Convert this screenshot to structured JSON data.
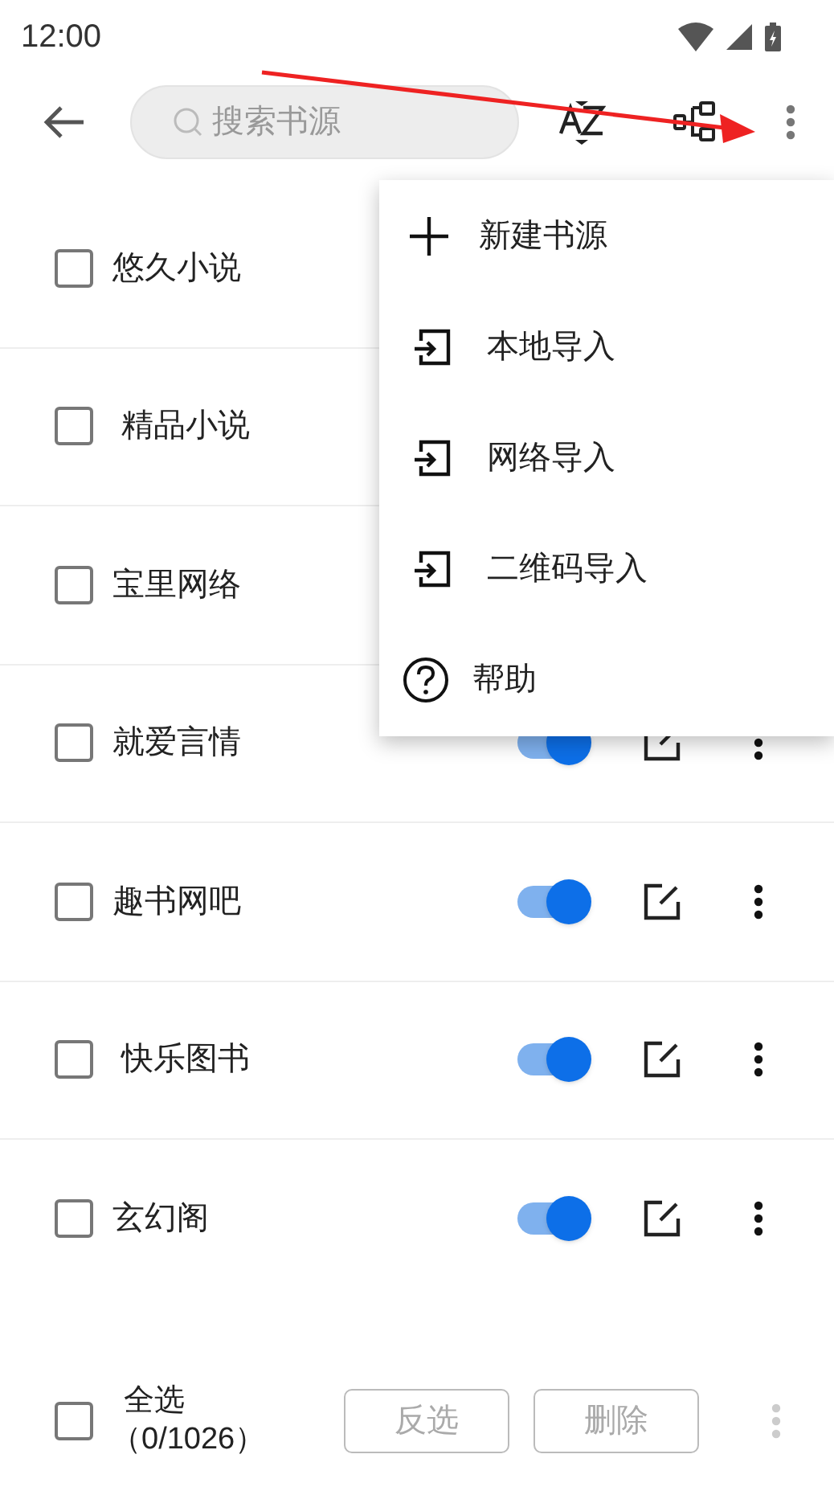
{
  "status_bar": {
    "time": "12:00"
  },
  "toolbar": {
    "search": {
      "placeholder": "搜索书源"
    }
  },
  "sources": [
    {
      "name": "悠久小说",
      "checked": false
    },
    {
      "name": " 精品小说",
      "checked": false
    },
    {
      "name": "宝里网络",
      "checked": false
    },
    {
      "name": "就爱言情",
      "checked": false,
      "on": true
    },
    {
      "name": "趣书网吧",
      "checked": false,
      "on": true
    },
    {
      "name": " 快乐图书",
      "checked": false,
      "on": true
    },
    {
      "name": "玄幻阁",
      "checked": false,
      "on": true
    }
  ],
  "menu": [
    {
      "kind": "add",
      "label": "新建书源"
    },
    {
      "kind": "import",
      "label": "本地导入"
    },
    {
      "kind": "import",
      "label": "网络导入"
    },
    {
      "kind": "import",
      "label": "二维码导入"
    },
    {
      "kind": "help",
      "label": "帮助"
    }
  ],
  "bottom_bar": {
    "select_all": {
      "label": "全选",
      "checked": false
    },
    "count": "（0/1026）",
    "buttons": [
      {
        "label": "反选",
        "disabled": true
      },
      {
        "label": "删除",
        "disabled": true
      }
    ]
  }
}
